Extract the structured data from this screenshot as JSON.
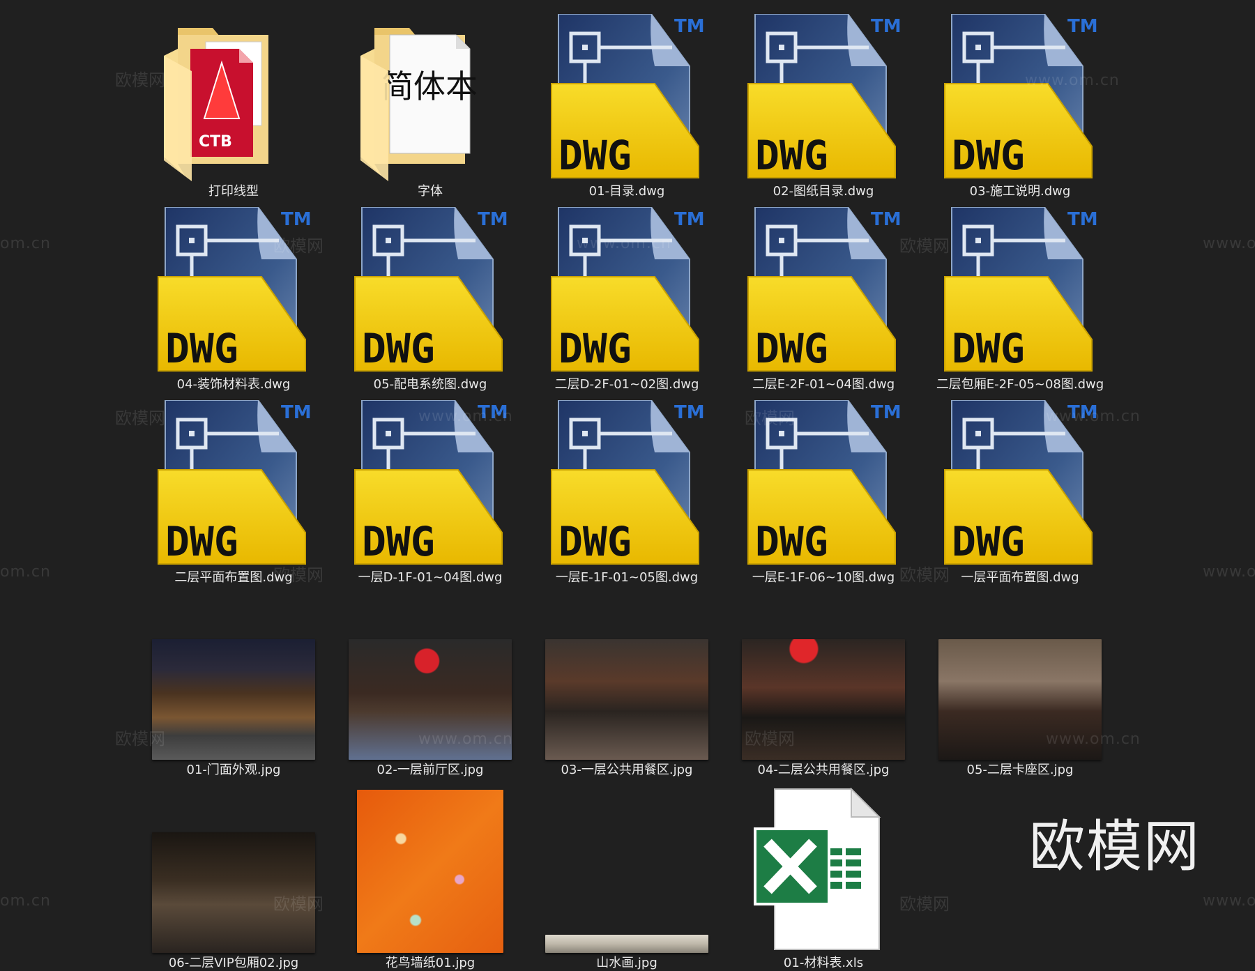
{
  "brand_watermark": "欧模网",
  "watermark_site": "欧模网",
  "watermark_url": "www.om.cn",
  "watermark_url_partial": "om.cn",
  "icons": {
    "dwg_type": "DWG",
    "dwg_trademark": "TM",
    "folder_print_badge": "CTB",
    "folder_font_preview": "简体本"
  },
  "files": [
    {
      "name": "打印线型",
      "type": "folder-ctb"
    },
    {
      "name": "字体",
      "type": "folder-font"
    },
    {
      "name": "01-目录.dwg",
      "type": "dwg"
    },
    {
      "name": "02-图纸目录.dwg",
      "type": "dwg"
    },
    {
      "name": "03-施工说明.dwg",
      "type": "dwg"
    },
    {
      "name": "04-装饰材料表.dwg",
      "type": "dwg"
    },
    {
      "name": "05-配电系统图.dwg",
      "type": "dwg"
    },
    {
      "name": "二层D-2F-01~02图.dwg",
      "type": "dwg"
    },
    {
      "name": "二层E-2F-01~04图.dwg",
      "type": "dwg"
    },
    {
      "name": "二层包厢E-2F-05~08图.dwg",
      "type": "dwg"
    },
    {
      "name": "二层平面布置图.dwg",
      "type": "dwg"
    },
    {
      "name": "一层D-1F-01~04图.dwg",
      "type": "dwg"
    },
    {
      "name": "一层E-1F-01~05图.dwg",
      "type": "dwg"
    },
    {
      "name": "一层E-1F-06~10图.dwg",
      "type": "dwg"
    },
    {
      "name": "一层平面布置图.dwg",
      "type": "dwg"
    },
    {
      "name": "01-门面外观.jpg",
      "type": "jpg-facade"
    },
    {
      "name": "02-一层前厅区.jpg",
      "type": "jpg-lobby"
    },
    {
      "name": "03-一层公共用餐区.jpg",
      "type": "jpg-dining1"
    },
    {
      "name": "04-二层公共用餐区.jpg",
      "type": "jpg-dining2"
    },
    {
      "name": "05-二层卡座区.jpg",
      "type": "jpg-booth"
    },
    {
      "name": "06-二层VIP包厢02.jpg",
      "type": "jpg-vip"
    },
    {
      "name": "花鸟墙纸01.jpg",
      "type": "jpg-wallpaper"
    },
    {
      "name": "山水画.jpg",
      "type": "jpg-landscape"
    },
    {
      "name": "01-材料表.xls",
      "type": "xls"
    }
  ]
}
